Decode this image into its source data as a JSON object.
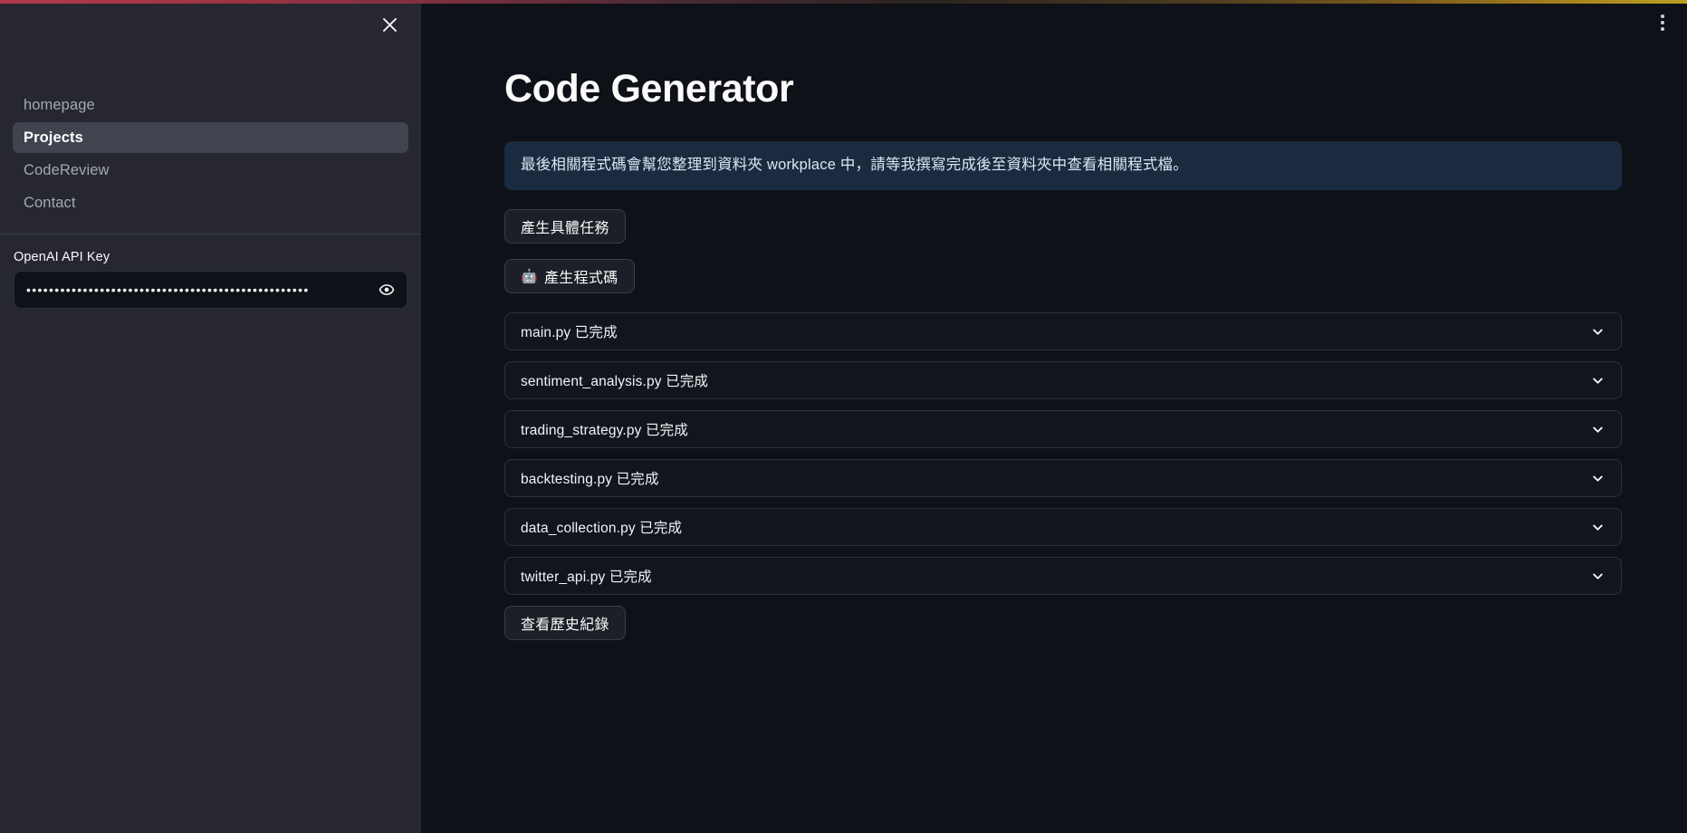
{
  "window": {
    "decoration_bar_gradient_from": "#b23a48",
    "decoration_bar_gradient_to": "#b9a021",
    "sidebar_bg": "#262730",
    "main_bg": "#0e1117",
    "accent_info_bg": "#1b2b3f",
    "selected_nav_bg": "#41434e"
  },
  "sidebar": {
    "close_label": "close-sidebar",
    "nav_items": [
      {
        "label": "homepage",
        "selected": false
      },
      {
        "label": "Projects",
        "selected": true
      },
      {
        "label": "CodeReview",
        "selected": false
      },
      {
        "label": "Contact",
        "selected": false
      }
    ],
    "api_key": {
      "label": "OpenAI API Key",
      "value": "••••••••••••••••••••••••••••••••••••••••••••••••••",
      "placeholder": "",
      "reveal_icon": "eye-icon"
    }
  },
  "main": {
    "menu_icon": "kebab-menu-icon",
    "title": "Code Generator",
    "info_banner": {
      "text": "最後相關程式碼會幫您整理到資料夾 workplace 中，請等我撰寫完成後至資料夾中查看相關程式檔。"
    },
    "buttons": {
      "generate_tasks": "產生具體任務",
      "generate_code_emoji": "🤖",
      "generate_code": "產生程式碼",
      "view_history": "查看歷史紀錄"
    },
    "accordions": [
      {
        "label": "main.py 已完成",
        "icon": "chevron-down-icon"
      },
      {
        "label": "sentiment_analysis.py 已完成",
        "icon": "chevron-down-icon"
      },
      {
        "label": "trading_strategy.py 已完成",
        "icon": "chevron-down-icon"
      },
      {
        "label": "backtesting.py 已完成",
        "icon": "chevron-down-icon"
      },
      {
        "label": "data_collection.py 已完成",
        "icon": "chevron-down-icon"
      },
      {
        "label": "twitter_api.py 已完成",
        "icon": "chevron-down-icon"
      }
    ]
  }
}
